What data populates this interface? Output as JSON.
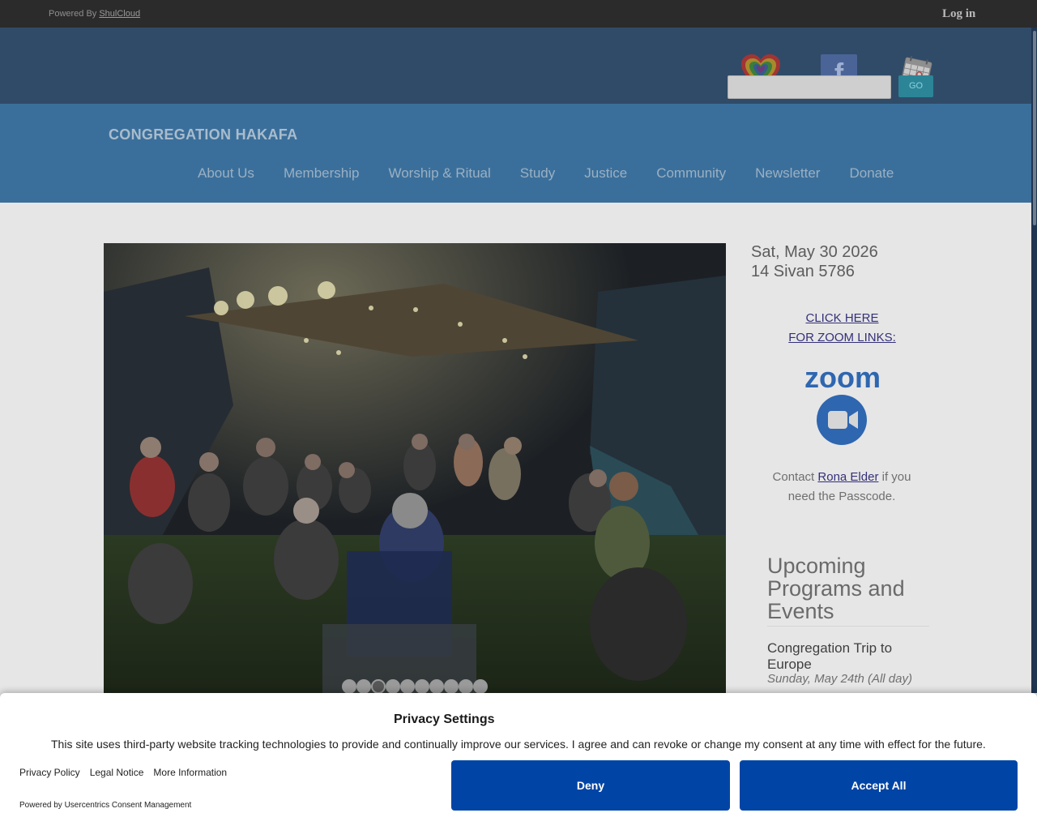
{
  "topbar": {
    "powered_prefix": "Powered By",
    "powered_link": "ShulCloud",
    "login": "Log in"
  },
  "header": {
    "icons": [
      "heart-icon",
      "facebook-icon",
      "calendar-icon"
    ],
    "search": {
      "value": "",
      "placeholder": ""
    },
    "go_label": "GO",
    "site_title": "CONGREGATION HAKAFA"
  },
  "nav": {
    "items": [
      {
        "label": "About Us"
      },
      {
        "label": "Membership"
      },
      {
        "label": "Worship & Ritual"
      },
      {
        "label": "Study"
      },
      {
        "label": "Justice"
      },
      {
        "label": "Community"
      },
      {
        "label": "Newsletter"
      },
      {
        "label": "Donate"
      }
    ]
  },
  "slider": {
    "slide_count": 10,
    "active_index": 2
  },
  "sidebar": {
    "date_gregorian": "Sat, May 30 2026",
    "date_hebrew": "14 Sivan 5786",
    "zoom_link_line1": "CLICK HERE",
    "zoom_link_line2": "FOR ZOOM LINKS:",
    "zoom_logo_text": "zoom",
    "contact_prefix": "Contact",
    "contact_name": "Rona Elder",
    "contact_suffix": "if you need the Passcode."
  },
  "events": {
    "title": "Upcoming Programs and Events",
    "items": [
      {
        "name": "Congregation Trip to Europe",
        "date": "Sunday, May 24th (All day)"
      }
    ]
  },
  "consent": {
    "title": "Privacy Settings",
    "text": "This site uses third-party website tracking technologies to provide and continually improve our services. I agree and can revoke or change my consent at any time with effect for the future.",
    "links": [
      "Privacy Policy",
      "Legal Notice",
      "More Information"
    ],
    "powered": "Powered by Usercentrics Consent Management",
    "deny_label": "Deny",
    "accept_label": "Accept All"
  },
  "colors": {
    "topbar": "#2b2b2b",
    "header_top": "#304b68",
    "header_main": "#3b6f9b",
    "consent_button": "#0045a5",
    "link": "#34307a"
  }
}
